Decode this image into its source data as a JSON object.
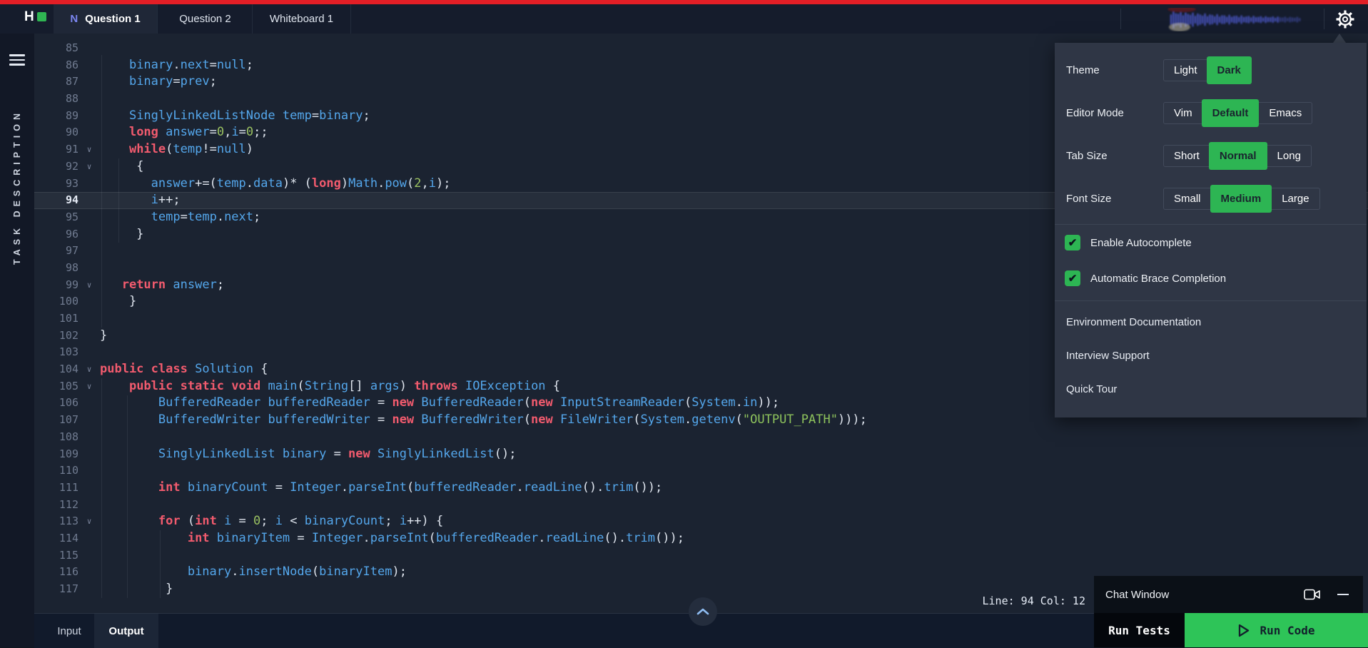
{
  "topbar": {
    "logo_letter": "H",
    "tabs": [
      {
        "badge": "N",
        "label": "Question 1",
        "active": true
      },
      {
        "label": "Question 2",
        "active": false
      },
      {
        "label": "Whiteboard 1",
        "active": false
      }
    ]
  },
  "sidebar": {
    "label": "TASK DESCRIPTION"
  },
  "editor": {
    "status": "Line: 94 Col: 12",
    "lines": [
      {
        "n": 85,
        "fold": false,
        "cur": false,
        "seg": []
      },
      {
        "n": 86,
        "fold": false,
        "cur": false,
        "seg": [
          [
            "p",
            "    "
          ],
          [
            "t",
            "binary"
          ],
          [
            "p",
            "."
          ],
          [
            "t",
            "next"
          ],
          [
            "p",
            "="
          ],
          [
            "t",
            "null"
          ],
          [
            "p",
            ";"
          ]
        ]
      },
      {
        "n": 87,
        "fold": false,
        "cur": false,
        "seg": [
          [
            "p",
            "    "
          ],
          [
            "t",
            "binary"
          ],
          [
            "p",
            "="
          ],
          [
            "t",
            "prev"
          ],
          [
            "p",
            ";"
          ]
        ]
      },
      {
        "n": 88,
        "fold": false,
        "cur": false,
        "seg": []
      },
      {
        "n": 89,
        "fold": false,
        "cur": false,
        "seg": [
          [
            "p",
            "    "
          ],
          [
            "t",
            "SinglyLinkedListNode"
          ],
          [
            "p",
            " "
          ],
          [
            "t",
            "temp"
          ],
          [
            "p",
            "="
          ],
          [
            "t",
            "binary"
          ],
          [
            "p",
            ";"
          ]
        ]
      },
      {
        "n": 90,
        "fold": false,
        "cur": false,
        "seg": [
          [
            "p",
            "    "
          ],
          [
            "k",
            "long"
          ],
          [
            "p",
            " "
          ],
          [
            "t",
            "answer"
          ],
          [
            "p",
            "="
          ],
          [
            "n",
            "0"
          ],
          [
            "p",
            ","
          ],
          [
            "t",
            "i"
          ],
          [
            "p",
            "="
          ],
          [
            "n",
            "0"
          ],
          [
            "p",
            ";;"
          ]
        ]
      },
      {
        "n": 91,
        "fold": true,
        "cur": false,
        "seg": [
          [
            "p",
            "    "
          ],
          [
            "k",
            "while"
          ],
          [
            "p",
            "("
          ],
          [
            "t",
            "temp"
          ],
          [
            "p",
            "!="
          ],
          [
            "t",
            "null"
          ],
          [
            "p",
            ")"
          ]
        ]
      },
      {
        "n": 92,
        "fold": true,
        "cur": false,
        "seg": [
          [
            "p",
            "     {"
          ]
        ]
      },
      {
        "n": 93,
        "fold": false,
        "cur": false,
        "seg": [
          [
            "p",
            "       "
          ],
          [
            "t",
            "answer"
          ],
          [
            "p",
            "+=("
          ],
          [
            "t",
            "temp"
          ],
          [
            "p",
            "."
          ],
          [
            "t",
            "data"
          ],
          [
            "p",
            ")* ("
          ],
          [
            "k",
            "long"
          ],
          [
            "p",
            ")"
          ],
          [
            "t",
            "Math"
          ],
          [
            "p",
            "."
          ],
          [
            "t",
            "pow"
          ],
          [
            "p",
            "("
          ],
          [
            "n",
            "2"
          ],
          [
            "p",
            ","
          ],
          [
            "t",
            "i"
          ],
          [
            "p",
            ");"
          ]
        ]
      },
      {
        "n": 94,
        "fold": false,
        "cur": true,
        "seg": [
          [
            "p",
            "       "
          ],
          [
            "t",
            "i"
          ],
          [
            "p",
            "++;"
          ]
        ]
      },
      {
        "n": 95,
        "fold": false,
        "cur": false,
        "seg": [
          [
            "p",
            "       "
          ],
          [
            "t",
            "temp"
          ],
          [
            "p",
            "="
          ],
          [
            "t",
            "temp"
          ],
          [
            "p",
            "."
          ],
          [
            "t",
            "next"
          ],
          [
            "p",
            ";"
          ]
        ]
      },
      {
        "n": 96,
        "fold": false,
        "cur": false,
        "seg": [
          [
            "p",
            "     }"
          ]
        ]
      },
      {
        "n": 97,
        "fold": false,
        "cur": false,
        "seg": []
      },
      {
        "n": 98,
        "fold": false,
        "cur": false,
        "seg": []
      },
      {
        "n": 99,
        "fold": true,
        "cur": false,
        "seg": [
          [
            "p",
            "   "
          ],
          [
            "k",
            "return"
          ],
          [
            "p",
            " "
          ],
          [
            "t",
            "answer"
          ],
          [
            "p",
            ";"
          ]
        ]
      },
      {
        "n": 100,
        "fold": false,
        "cur": false,
        "seg": [
          [
            "p",
            "    }"
          ]
        ]
      },
      {
        "n": 101,
        "fold": false,
        "cur": false,
        "seg": []
      },
      {
        "n": 102,
        "fold": false,
        "cur": false,
        "seg": [
          [
            "p",
            "}"
          ]
        ]
      },
      {
        "n": 103,
        "fold": false,
        "cur": false,
        "seg": []
      },
      {
        "n": 104,
        "fold": true,
        "cur": false,
        "seg": [
          [
            "k",
            "public"
          ],
          [
            "p",
            " "
          ],
          [
            "k",
            "class"
          ],
          [
            "p",
            " "
          ],
          [
            "t",
            "Solution"
          ],
          [
            "p",
            " {"
          ]
        ]
      },
      {
        "n": 105,
        "fold": true,
        "cur": false,
        "seg": [
          [
            "p",
            "    "
          ],
          [
            "k",
            "public"
          ],
          [
            "p",
            " "
          ],
          [
            "k",
            "static"
          ],
          [
            "p",
            " "
          ],
          [
            "k",
            "void"
          ],
          [
            "p",
            " "
          ],
          [
            "t",
            "main"
          ],
          [
            "p",
            "("
          ],
          [
            "t",
            "String"
          ],
          [
            "p",
            "[] "
          ],
          [
            "t",
            "args"
          ],
          [
            "p",
            ") "
          ],
          [
            "k",
            "throws"
          ],
          [
            "p",
            " "
          ],
          [
            "t",
            "IOException"
          ],
          [
            "p",
            " {"
          ]
        ]
      },
      {
        "n": 106,
        "fold": false,
        "cur": false,
        "seg": [
          [
            "p",
            "        "
          ],
          [
            "t",
            "BufferedReader"
          ],
          [
            "p",
            " "
          ],
          [
            "t",
            "bufferedReader"
          ],
          [
            "p",
            " = "
          ],
          [
            "k",
            "new"
          ],
          [
            "p",
            " "
          ],
          [
            "t",
            "BufferedReader"
          ],
          [
            "p",
            "("
          ],
          [
            "k",
            "new"
          ],
          [
            "p",
            " "
          ],
          [
            "t",
            "InputStreamReader"
          ],
          [
            "p",
            "("
          ],
          [
            "t",
            "System"
          ],
          [
            "p",
            "."
          ],
          [
            "t",
            "in"
          ],
          [
            "p",
            "));"
          ]
        ]
      },
      {
        "n": 107,
        "fold": false,
        "cur": false,
        "seg": [
          [
            "p",
            "        "
          ],
          [
            "t",
            "BufferedWriter"
          ],
          [
            "p",
            " "
          ],
          [
            "t",
            "bufferedWriter"
          ],
          [
            "p",
            " = "
          ],
          [
            "k",
            "new"
          ],
          [
            "p",
            " "
          ],
          [
            "t",
            "BufferedWriter"
          ],
          [
            "p",
            "("
          ],
          [
            "k",
            "new"
          ],
          [
            "p",
            " "
          ],
          [
            "t",
            "FileWriter"
          ],
          [
            "p",
            "("
          ],
          [
            "t",
            "System"
          ],
          [
            "p",
            "."
          ],
          [
            "t",
            "getenv"
          ],
          [
            "p",
            "("
          ],
          [
            "s",
            "\"OUTPUT_PATH\""
          ],
          [
            "p",
            ")));"
          ]
        ]
      },
      {
        "n": 108,
        "fold": false,
        "cur": false,
        "seg": []
      },
      {
        "n": 109,
        "fold": false,
        "cur": false,
        "seg": [
          [
            "p",
            "        "
          ],
          [
            "t",
            "SinglyLinkedList"
          ],
          [
            "p",
            " "
          ],
          [
            "t",
            "binary"
          ],
          [
            "p",
            " = "
          ],
          [
            "k",
            "new"
          ],
          [
            "p",
            " "
          ],
          [
            "t",
            "SinglyLinkedList"
          ],
          [
            "p",
            "();"
          ]
        ]
      },
      {
        "n": 110,
        "fold": false,
        "cur": false,
        "seg": []
      },
      {
        "n": 111,
        "fold": false,
        "cur": false,
        "seg": [
          [
            "p",
            "        "
          ],
          [
            "k",
            "int"
          ],
          [
            "p",
            " "
          ],
          [
            "t",
            "binaryCount"
          ],
          [
            "p",
            " = "
          ],
          [
            "t",
            "Integer"
          ],
          [
            "p",
            "."
          ],
          [
            "t",
            "parseInt"
          ],
          [
            "p",
            "("
          ],
          [
            "t",
            "bufferedReader"
          ],
          [
            "p",
            "."
          ],
          [
            "t",
            "readLine"
          ],
          [
            "p",
            "()."
          ],
          [
            "t",
            "trim"
          ],
          [
            "p",
            "());"
          ]
        ]
      },
      {
        "n": 112,
        "fold": false,
        "cur": false,
        "seg": []
      },
      {
        "n": 113,
        "fold": true,
        "cur": false,
        "seg": [
          [
            "p",
            "        "
          ],
          [
            "k",
            "for"
          ],
          [
            "p",
            " ("
          ],
          [
            "k",
            "int"
          ],
          [
            "p",
            " "
          ],
          [
            "t",
            "i"
          ],
          [
            "p",
            " = "
          ],
          [
            "n",
            "0"
          ],
          [
            "p",
            "; "
          ],
          [
            "t",
            "i"
          ],
          [
            "p",
            " < "
          ],
          [
            "t",
            "binaryCount"
          ],
          [
            "p",
            "; "
          ],
          [
            "t",
            "i"
          ],
          [
            "p",
            "++) {"
          ]
        ]
      },
      {
        "n": 114,
        "fold": false,
        "cur": false,
        "seg": [
          [
            "p",
            "            "
          ],
          [
            "k",
            "int"
          ],
          [
            "p",
            " "
          ],
          [
            "t",
            "binaryItem"
          ],
          [
            "p",
            " = "
          ],
          [
            "t",
            "Integer"
          ],
          [
            "p",
            "."
          ],
          [
            "t",
            "parseInt"
          ],
          [
            "p",
            "("
          ],
          [
            "t",
            "bufferedReader"
          ],
          [
            "p",
            "."
          ],
          [
            "t",
            "readLine"
          ],
          [
            "p",
            "()."
          ],
          [
            "t",
            "trim"
          ],
          [
            "p",
            "());"
          ]
        ]
      },
      {
        "n": 115,
        "fold": false,
        "cur": false,
        "seg": []
      },
      {
        "n": 116,
        "fold": false,
        "cur": false,
        "seg": [
          [
            "p",
            "            "
          ],
          [
            "t",
            "binary"
          ],
          [
            "p",
            "."
          ],
          [
            "t",
            "insertNode"
          ],
          [
            "p",
            "("
          ],
          [
            "t",
            "binaryItem"
          ],
          [
            "p",
            ");"
          ]
        ]
      },
      {
        "n": 117,
        "fold": false,
        "cur": false,
        "seg": [
          [
            "p",
            "         }"
          ]
        ]
      }
    ]
  },
  "settings": {
    "rows": [
      {
        "label": "Theme",
        "options": [
          "Light",
          "Dark"
        ],
        "selected": "Dark"
      },
      {
        "label": "Editor Mode",
        "options": [
          "Vim",
          "Default",
          "Emacs"
        ],
        "selected": "Default"
      },
      {
        "label": "Tab Size",
        "options": [
          "Short",
          "Normal",
          "Long"
        ],
        "selected": "Normal"
      },
      {
        "label": "Font Size",
        "options": [
          "Small",
          "Medium",
          "Large"
        ],
        "selected": "Medium"
      }
    ],
    "checkboxes": [
      {
        "label": "Enable Autocomplete",
        "checked": true
      },
      {
        "label": "Automatic Brace Completion",
        "checked": true
      }
    ],
    "links": [
      "Environment Documentation",
      "Interview Support",
      "Quick Tour"
    ]
  },
  "bottom": {
    "tab_input": "Input",
    "tab_output": "Output",
    "run_tests": "Run Tests",
    "run_code": "Run Code"
  },
  "chat": {
    "title": "Chat Window"
  },
  "colors": {
    "accent_green": "#2db553",
    "top_strip_red": "#e31e26",
    "keyword_red": "#f25b6e",
    "identifier_blue": "#54a7ec",
    "literal_green": "#9ac161",
    "badge_indigo": "#7b86f0"
  }
}
